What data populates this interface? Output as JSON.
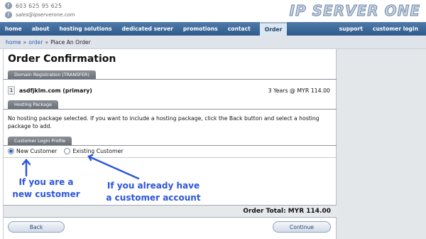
{
  "contact": {
    "phone_icon": "f",
    "phone": "603 625 95 625",
    "email_icon": "f",
    "email": "sales@ipserverone.com"
  },
  "logo": {
    "text": "IP SERVER ONE"
  },
  "nav": {
    "items": [
      "home",
      "about",
      "hosting solutions",
      "dedicated server",
      "promotions",
      "contact"
    ],
    "active": "Order",
    "right": [
      "support",
      "customer login"
    ]
  },
  "breadcrumb": {
    "home": "home",
    "order": "order",
    "current": "Place An Order",
    "sep": "»"
  },
  "page": {
    "title": "Order Confirmation",
    "sections": {
      "domain": "Domain Registration (TRANSFER)",
      "hosting": "Hosting Package",
      "login": "Customer Login Profile"
    },
    "domain_row": {
      "index": "1",
      "name": "asdfjklm.com (primary)",
      "term": "3 Years @ MYR 114.00"
    },
    "hosting_note": "No hosting package selected. If you want to include a hosting package, click the Back button and select a hosting package to add.",
    "radios": {
      "new": "New Customer",
      "existing": "Existing Customer",
      "selected": "new"
    },
    "total": {
      "label": "Order Total:",
      "value": "MYR 114.00"
    },
    "buttons": {
      "back": "Back",
      "continue": "Continue"
    }
  },
  "annotations": {
    "a1_line1": "If you are a",
    "a1_line2": "new customer",
    "a2_line1": "If you already have",
    "a2_line2": "a customer account",
    "color": "#2b56d9"
  }
}
